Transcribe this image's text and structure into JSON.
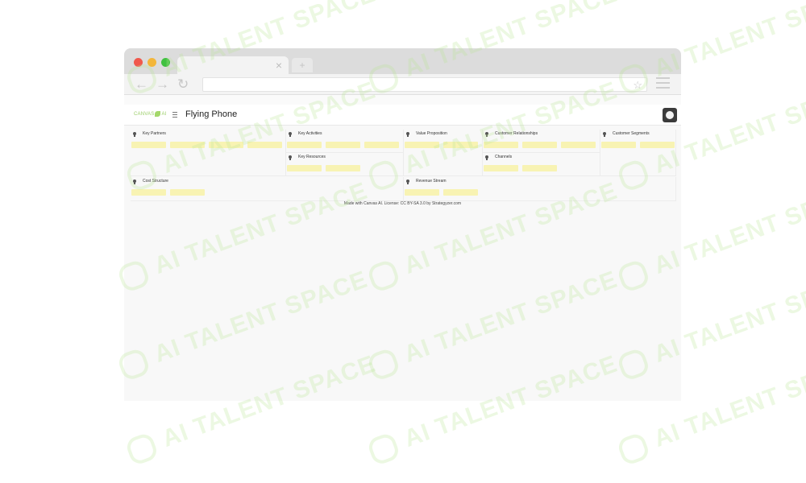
{
  "browser": {
    "tab_close": "×",
    "new_tab": "+",
    "nav": {
      "back": "←",
      "forward": "→",
      "reload": "↻"
    },
    "star": "☆"
  },
  "app": {
    "logo_left": "CANVAS",
    "logo_right": "AI",
    "title": "Flying Phone"
  },
  "canvas": {
    "blocks": [
      {
        "label": "Key Partners",
        "stickies": 4
      },
      {
        "label": "Key Activities",
        "stickies": 3
      },
      {
        "label": "Key Resources",
        "stickies": 2
      },
      {
        "label": "Value Proposition",
        "stickies": 2
      },
      {
        "label": "Customer Relationships",
        "stickies": 3
      },
      {
        "label": "Channels",
        "stickies": 2
      },
      {
        "label": "Customer Segments",
        "stickies": 2
      },
      {
        "label": "Cost Structure",
        "stickies": 2
      },
      {
        "label": "Revenue Stream",
        "stickies": 2
      }
    ]
  },
  "footer": "Made with Canvas AI. License: CC BY-SA 3.0 by Strategyzer.com",
  "watermark": {
    "text": "AI TALENT SPACE"
  },
  "colors": {
    "sticky": "#f8f3b3",
    "watermark": "#bce696",
    "logo": "#9ccf6a"
  }
}
